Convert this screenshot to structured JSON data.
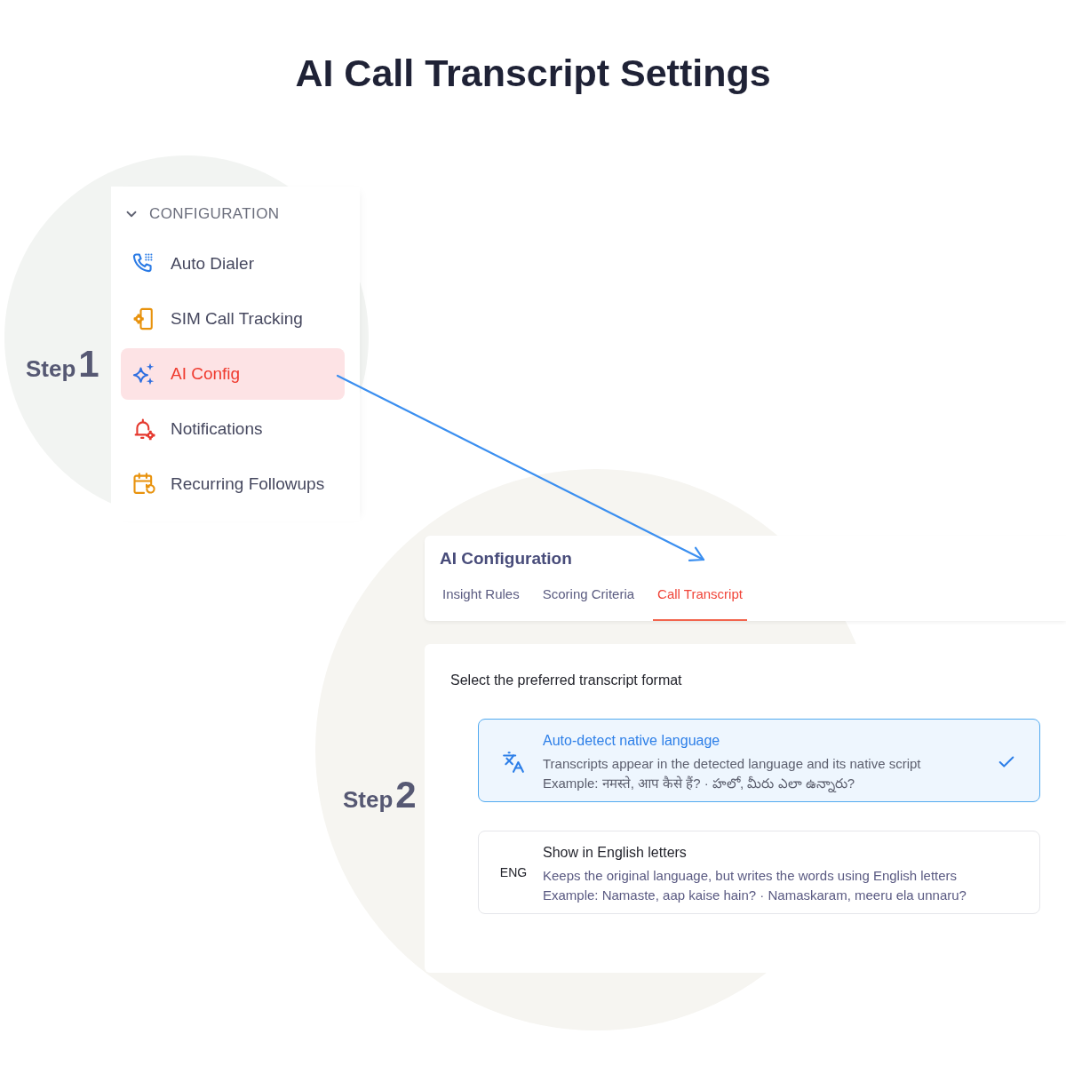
{
  "title": "AI Call Transcript Settings",
  "step_one": {
    "label": "Step",
    "number": "1",
    "sidebar": {
      "section": {
        "label": "CONFIGURATION",
        "expanded": true
      },
      "items": [
        {
          "label": "Auto Dialer",
          "selected": false
        },
        {
          "label": "SIM Call Tracking",
          "selected": false
        },
        {
          "label": "AI Config",
          "selected": true
        },
        {
          "label": "Notifications",
          "selected": false
        },
        {
          "label": "Recurring Followups",
          "selected": false
        }
      ]
    }
  },
  "step_two": {
    "label": "Step",
    "number": "2",
    "header": {
      "title": "AI Configuration",
      "tabs": [
        {
          "label": "Insight Rules",
          "selected": false
        },
        {
          "label": "Scoring Criteria",
          "selected": false
        },
        {
          "label": "Call Transcript",
          "selected": true
        }
      ]
    },
    "content": {
      "prompt": "Select the preferred transcript format",
      "options": [
        {
          "kind": "icon",
          "title": "Auto-detect native language",
          "description": "Transcripts appear in the detected language and its native script",
          "example": "Example: नमस्ते, आप कैसे हैं? · హలో, మీరు ఎలా ఉన్నారు?",
          "selected": true
        },
        {
          "kind": "code",
          "code": "ENG",
          "title": "Show in English letters",
          "description": "Keeps the original language, but writes the words using English letters",
          "example": "Example: Namaste, aap kaise hain? · Namaskaram, meeru ela unnaru?",
          "selected": false
        }
      ]
    }
  }
}
